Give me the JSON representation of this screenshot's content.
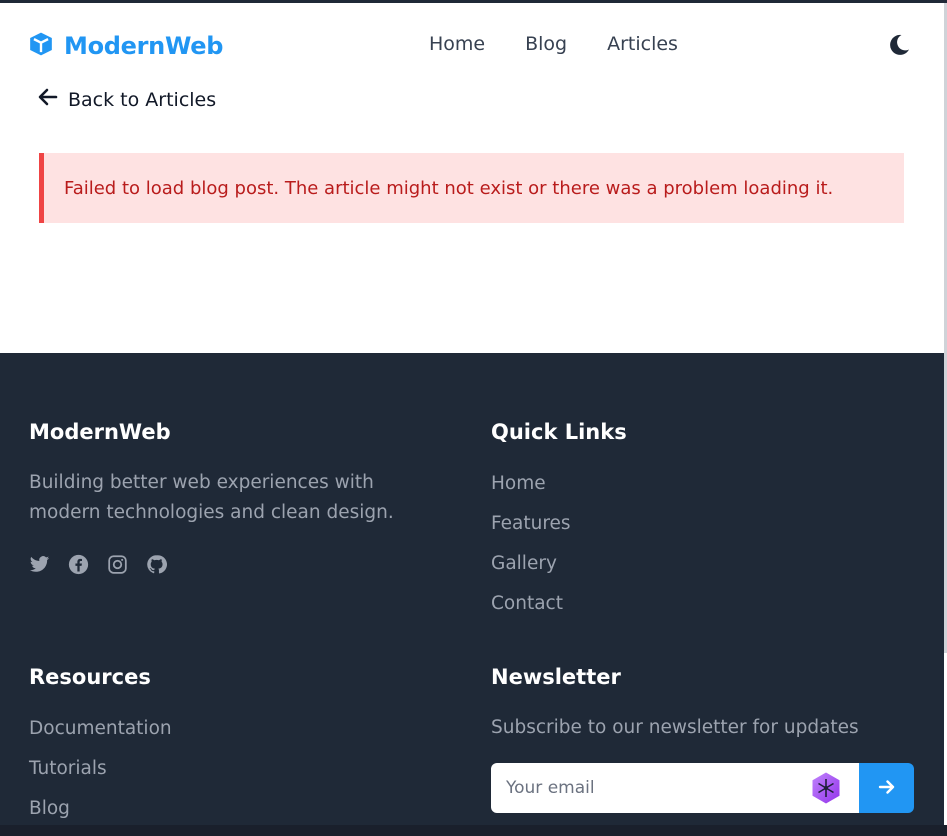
{
  "header": {
    "brand": "ModernWeb",
    "nav": [
      "Home",
      "Blog",
      "Articles"
    ]
  },
  "back_link": "Back to Articles",
  "error_message": "Failed to load blog post. The article might not exist or there was a problem loading it.",
  "footer": {
    "about": {
      "title": "ModernWeb",
      "description": "Building better web experiences with modern technologies and clean design.",
      "social_icons": [
        "twitter-icon",
        "facebook-icon",
        "instagram-icon",
        "github-icon"
      ]
    },
    "quick_links": {
      "title": "Quick Links",
      "items": [
        "Home",
        "Features",
        "Gallery",
        "Contact"
      ]
    },
    "resources": {
      "title": "Resources",
      "items": [
        "Documentation",
        "Tutorials",
        "Blog"
      ]
    },
    "newsletter": {
      "title": "Newsletter",
      "description": "Subscribe to our newsletter for updates",
      "placeholder": "Your email"
    }
  },
  "colors": {
    "brand": "#2196f3",
    "footer_bg": "#1f2937",
    "error_bg": "#fee2e2",
    "error_border": "#ef4444",
    "error_text": "#b91c1c"
  }
}
